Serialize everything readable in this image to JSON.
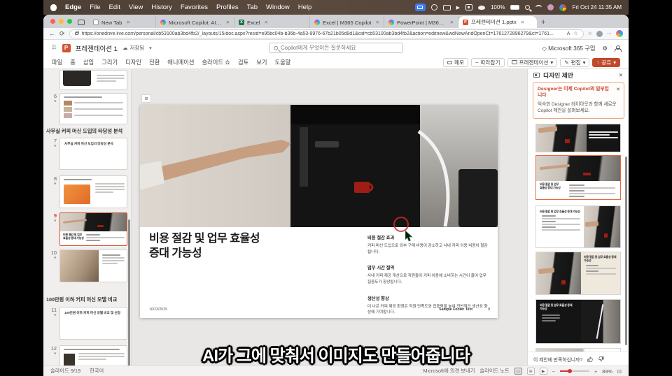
{
  "menubar": {
    "items": [
      "Edge",
      "File",
      "Edit",
      "View",
      "History",
      "Favorites",
      "Profiles",
      "Tab",
      "Window",
      "Help"
    ],
    "battery": "100%",
    "clock": "Fri Oct 24 11:35 AM"
  },
  "browser": {
    "tabs": [
      {
        "label": "New Tab"
      },
      {
        "label": "Microsoft Copilot: AI 컴패니언"
      },
      {
        "label": "Excel"
      },
      {
        "label": "Excel | M365 Copilot"
      },
      {
        "label": "PowerPoint | M365 Copilot"
      },
      {
        "label": "프레젠테이션 1.pptx"
      }
    ],
    "url": "https://onedrive.live.com/personal/cb53100ab3bd4fb2/_layouts/15/doc.aspx?resid=e95bc04b-b36b-4a53-9976-67b21b05d9d1&cid=cb53100ab3bd4fb2&action=editnew&wdNewAndOpenCt=1761272896279&ct=1761..."
  },
  "app_header": {
    "title": "프레젠테이션 1",
    "saved": "저장됨",
    "search_placeholder": "Copilot에게 무엇이든 질문하세요",
    "buy": "Microsoft 365 구입"
  },
  "ribbon": {
    "tabs": [
      "파일",
      "홈",
      "삽입",
      "그리기",
      "디자인",
      "전환",
      "애니메이션",
      "슬라이드 쇼",
      "검토",
      "보기",
      "도움말"
    ],
    "comments": "메모",
    "catch_up": "따라잡기",
    "present": "프레젠테이션",
    "editing": "편집",
    "share": "공유"
  },
  "sidebar": {
    "section1": "사무실 커피 머신 도입의 타당성 분석",
    "section2": "100만원 이하 커피 머신 모델 비교",
    "slide7_title": "사무실 커피 머신 도입의 타당성 분석",
    "slide11_title": "100만원 이하 커피 머신 모델 비교 및 선정",
    "numbers": [
      "6",
      "7",
      "8",
      "9",
      "10",
      "11",
      "12"
    ]
  },
  "slide": {
    "title": "비용 절감 및 업무 효율성 증대 가능성",
    "date": "10/23/2025",
    "footer": "Sample Footer Text",
    "page": "9",
    "sections": [
      {
        "heading": "비용 절감 효과",
        "body": "커피 머신 도입으로 외부 구매 비용이 감소하고 사내 커피 이용 비용이 절감됩니다."
      },
      {
        "heading": "업무 시간 절약",
        "body": "사내 커피 제공 개선으로 직원들이 커피 이용에 소비하는 시간이 줄어 업무 집중도가 향상됩니다."
      },
      {
        "heading": "생산성 향상",
        "body": "더 나은 커피 제공 환경은 직원 만족도와 집중력을 높여 전반적인 생산성 향상에 기여합니다."
      }
    ]
  },
  "designer": {
    "title": "디자인 제안",
    "notice_title": "Designer는 이제 Copilot의 일부입니다",
    "notice_body": "익숙한 Designer 레이아웃과 함께 새로운 Copilot 제안을 살펴보세요.",
    "feedback": "이 제안에 만족하십니까?"
  },
  "statusbar": {
    "slide_info": "슬라이드 9/19",
    "language": "한국어",
    "send_feedback": "Microsoft에 의견 보내기",
    "notes": "슬라이드 노트",
    "zoom": "89%"
  },
  "subtitle": "AI가 그에 맞춰서 이미지도 만들어줍니다",
  "colors": {
    "accent_orange": "#c74634",
    "share_button": "#bf4b2b",
    "selection_border": "#d35230",
    "badge_blue": "#3a7bf6"
  },
  "icons": {
    "close": "✕",
    "chevron_down": "▾",
    "back": "←",
    "refresh": "⟳",
    "more": "⋯",
    "star": "☆",
    "plus": "+",
    "minus": "−",
    "gear": "⚙",
    "pencil": "✎",
    "cloud": "☁",
    "check": "✓",
    "diamond": "◇",
    "grid": "⊞",
    "fit": "⊡",
    "up_arrow": "↑",
    "tilde": "~",
    "read_aloud": "A",
    "play": "▶",
    "waffle": "⠿",
    "fav_letter_excel": "X",
    "fav_letter_ppt": "P"
  }
}
